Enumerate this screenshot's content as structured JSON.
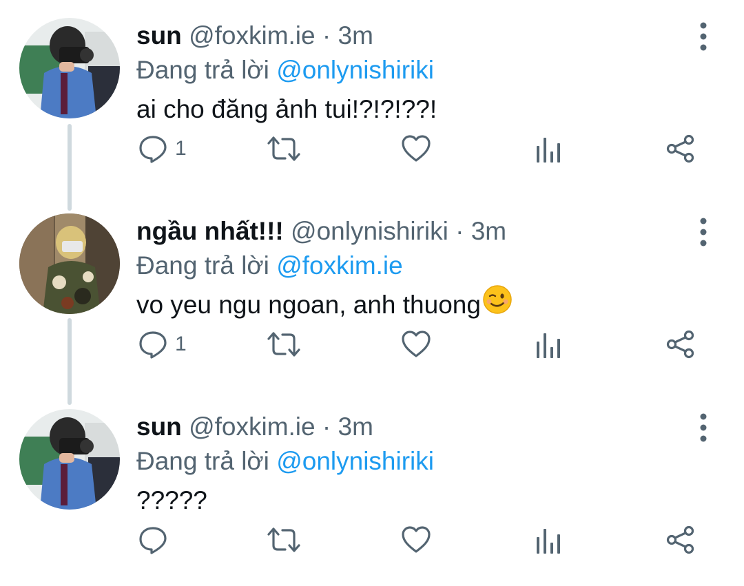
{
  "colors": {
    "link": "#1d9bf0",
    "muted": "#536471",
    "text": "#0f1419",
    "thread": "#cfd9de"
  },
  "tweets": [
    {
      "name": "sun",
      "handle": "@foxkim.ie",
      "separator": "·",
      "time": "3m",
      "reply_prefix": "Đang trả lời",
      "reply_to": "@onlynishiriki",
      "text": "ai cho đăng ảnh tui!?!?!??!",
      "reply_count": "1",
      "icons": [
        "reply-icon",
        "retweet-icon",
        "like-icon",
        "analytics-icon",
        "share-icon",
        "more-icon"
      ]
    },
    {
      "name": "ngầu nhất!!!",
      "handle": "@onlynishiriki",
      "separator": "·",
      "time": "3m",
      "reply_prefix": "Đang trả lời",
      "reply_to": "@foxkim.ie",
      "text": "vo yeu ngu ngoan, anh thuong",
      "emoji": "winking-face",
      "reply_count": "1",
      "icons": [
        "reply-icon",
        "retweet-icon",
        "like-icon",
        "analytics-icon",
        "share-icon",
        "more-icon"
      ]
    },
    {
      "name": "sun",
      "handle": "@foxkim.ie",
      "separator": "·",
      "time": "3m",
      "reply_prefix": "Đang trả lời",
      "reply_to": "@onlynishiriki",
      "text": "?????",
      "reply_count": "",
      "icons": [
        "reply-icon",
        "retweet-icon",
        "like-icon",
        "analytics-icon",
        "share-icon",
        "more-icon"
      ]
    }
  ]
}
